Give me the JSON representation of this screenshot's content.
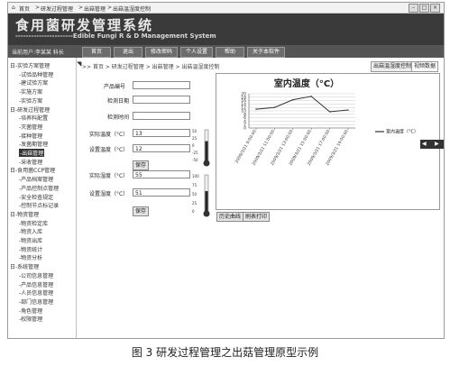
{
  "browser": {
    "crumb": [
      "首页",
      "研发过程管理",
      "出菇管理",
      "出菇温湿度控制"
    ]
  },
  "banner": {
    "title_cn": "食用菌研发管理系统",
    "title_en": "----------------------Edible Fungi R & D Management System"
  },
  "navbar": {
    "user": "当前用户:李某某 科长",
    "items": [
      "首页",
      "退出",
      "修改密码",
      "个人设置",
      "帮助",
      "关于本软件"
    ]
  },
  "sidebar": [
    {
      "text": "日-实验方案管理",
      "level": 0
    },
    {
      "text": "-试验品种管理",
      "level": 1
    },
    {
      "text": "-建试验方案",
      "level": 1
    },
    {
      "text": "-实施方案",
      "level": 1
    },
    {
      "text": "-实验方案",
      "level": 1
    },
    {
      "text": "日-研发过程管理",
      "level": 0
    },
    {
      "text": "-培养料配置",
      "level": 1
    },
    {
      "text": "-灭菌管理",
      "level": 1
    },
    {
      "text": "-接种管理",
      "level": 1
    },
    {
      "text": "-发菌期管理",
      "level": 1
    },
    {
      "text": "-出菇管理",
      "level": 1,
      "active": true
    },
    {
      "text": "-采收管理",
      "level": 1
    },
    {
      "text": "日-食用菌CCP管理",
      "level": 0
    },
    {
      "text": "-产品档案管理",
      "level": 1
    },
    {
      "text": "-产品控制点管理",
      "level": 1
    },
    {
      "text": "-安全检查规定",
      "level": 1
    },
    {
      "text": "-控制节点标记录",
      "level": 1
    },
    {
      "text": "日-物资管理",
      "level": 0
    },
    {
      "text": "-物资检定库",
      "level": 1
    },
    {
      "text": "-物资入库",
      "level": 1
    },
    {
      "text": "-物资出库",
      "level": 1
    },
    {
      "text": "-物资统计",
      "level": 1
    },
    {
      "text": "-物资分析",
      "level": 1
    },
    {
      "text": "日-系统管理",
      "level": 0
    },
    {
      "text": "-公司信息管理",
      "level": 1
    },
    {
      "text": "-产品信息管理",
      "level": 1
    },
    {
      "text": "-人员信息管理",
      "level": 1
    },
    {
      "text": "-部门信息管理",
      "level": 1
    },
    {
      "text": "-角色管理",
      "level": 1
    },
    {
      "text": "-权限管理",
      "level": 1
    }
  ],
  "main": {
    "breadcrumb": ">> 首页 > 研发过程管理 > 出菇管理 > 出菇温湿度控制",
    "tabs": [
      "出菇温湿度控制",
      "视频数据"
    ],
    "form": {
      "product_no_label": "产品编号",
      "check_date_label": "检测日期",
      "check_time_label": "检测时间",
      "actual_temp_label": "实际温度（°C）",
      "actual_temp_value": "13",
      "set_temp_label": "设置温度（°C）",
      "set_temp_value": "12",
      "save_label": "保存",
      "actual_hum_label": "实际湿度（°C）",
      "actual_hum_value": "55",
      "set_hum_label": "设置湿度（°C）",
      "set_hum_value": "51",
      "save2_label": "保存"
    },
    "temp_gauge": {
      "ticks": [
        "50",
        "25",
        "0",
        "-25",
        "-50"
      ],
      "level": 0.63
    },
    "hum_gauge": {
      "ticks": [
        "100",
        "75",
        "50",
        "25",
        "0"
      ],
      "level": 0.55
    },
    "history_button": "历史曲线",
    "print_button": "刷表打印"
  },
  "chart_data": {
    "type": "line",
    "title": "室内温度（°C）",
    "x": [
      "2009/3/21 9:00:00",
      "2009/3/21 11:00:00",
      "2009/3/21 13:00:00",
      "2009/3/21 15:00:00",
      "2009/3/21 17:00:00",
      "2009/3/21 19:00:00"
    ],
    "series": [
      {
        "name": "室内温度（°C）",
        "values": [
          11,
          12,
          16.5,
          18.5,
          9.5,
          10.5
        ]
      }
    ],
    "y_ticks": [
      0,
      2,
      4,
      6,
      8,
      10,
      12,
      14,
      16,
      18,
      20
    ],
    "ylim": [
      0,
      20
    ],
    "grid": true,
    "legend": "right",
    "colors": {
      "line": "#333333"
    }
  },
  "caption": "图 3 研发过程管理之出菇管理原型示例"
}
